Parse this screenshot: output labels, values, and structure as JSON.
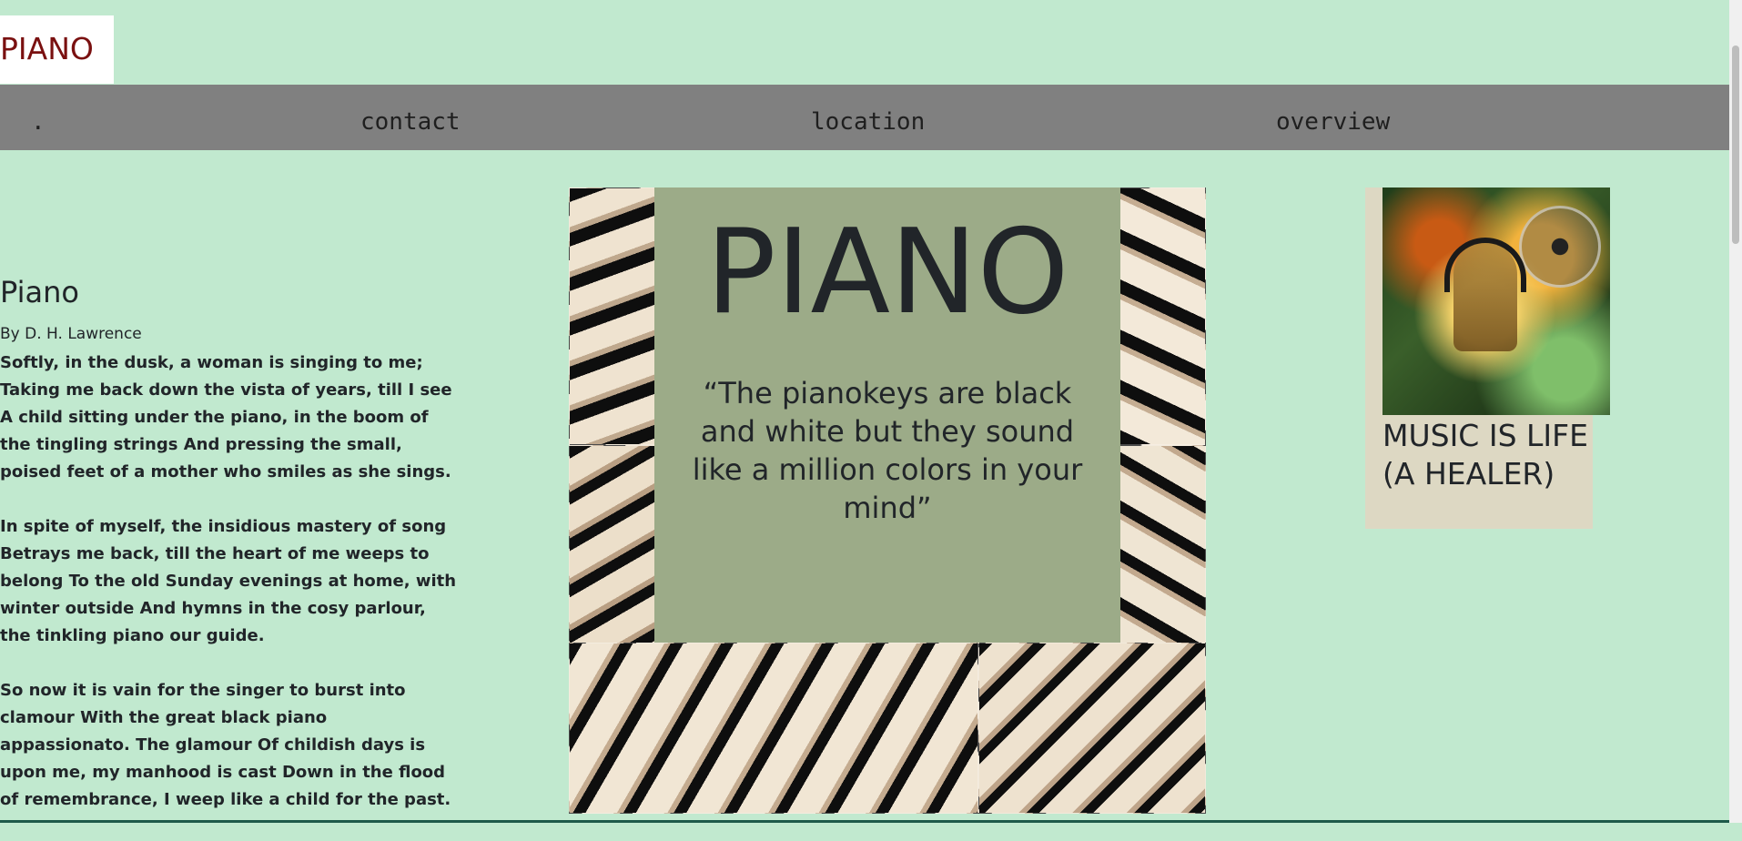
{
  "header": {
    "logo": "PIANO"
  },
  "nav": {
    "items": [
      ".",
      "contact",
      "location",
      "overview"
    ]
  },
  "poem": {
    "title": "Piano",
    "author": "By D. H. Lawrence",
    "stanzas": [
      "Softly, in the dusk, a woman is singing to me; Taking me back down the vista of years, till I see A child sitting under the piano, in the boom of the tingling strings And pressing the small, poised feet of a mother who smiles as she sings.",
      "In spite of myself, the insidious mastery of song Betrays me back, till the heart of me weeps to belong To the old Sunday evenings at home, with winter outside And hymns in the cosy parlour, the tinkling piano our guide.",
      "So now it is vain for the singer to burst into clamour With the great black piano appassionato. The glamour Of childish days is upon me, my manhood is cast Down in the flood of remembrance, I weep like a child for the past."
    ]
  },
  "hero": {
    "title": "PIANO",
    "quote": "“The pianokeys are black and white but they sound like a million colors in your mind”"
  },
  "side": {
    "caption": "MUSIC IS LIFE (A HEALER)",
    "image_icon": "music-woman-headphones-image"
  },
  "colors": {
    "background": "#c1e9cf",
    "navbar": "#808080",
    "logo_text": "#7a1010",
    "hero_box": "#9cab88",
    "side_card": "#ddd8c3"
  }
}
